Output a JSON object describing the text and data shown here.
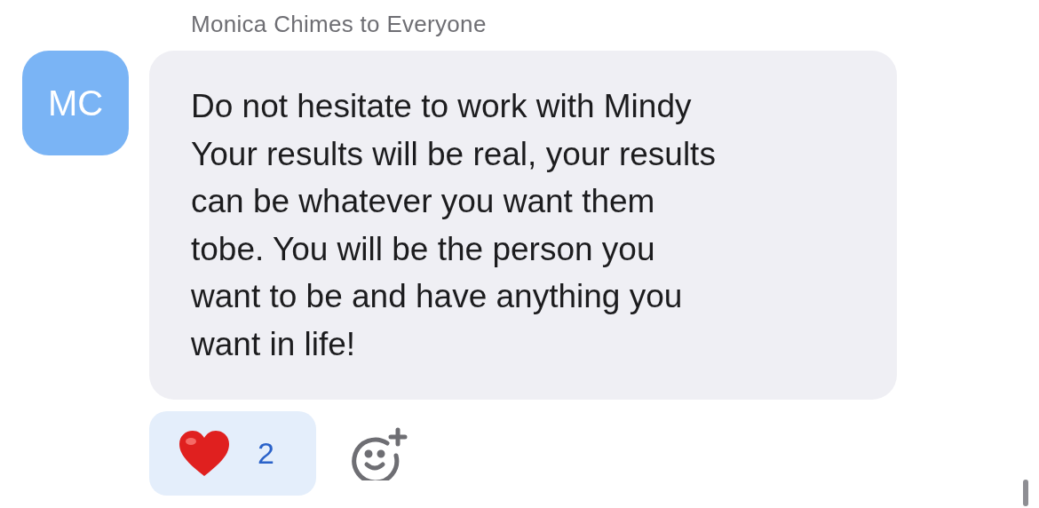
{
  "message": {
    "sender_line": "Monica Chimes to Everyone",
    "avatar_initials": "MC",
    "text": "Do not hesitate to work with Mindy\nYour results will be real, your results\ncan be whatever you want them\ntobe.  You will be the person you\nwant to be and have anything you\nwant in life!",
    "reactions": [
      {
        "count": "2",
        "selected": true
      }
    ]
  }
}
